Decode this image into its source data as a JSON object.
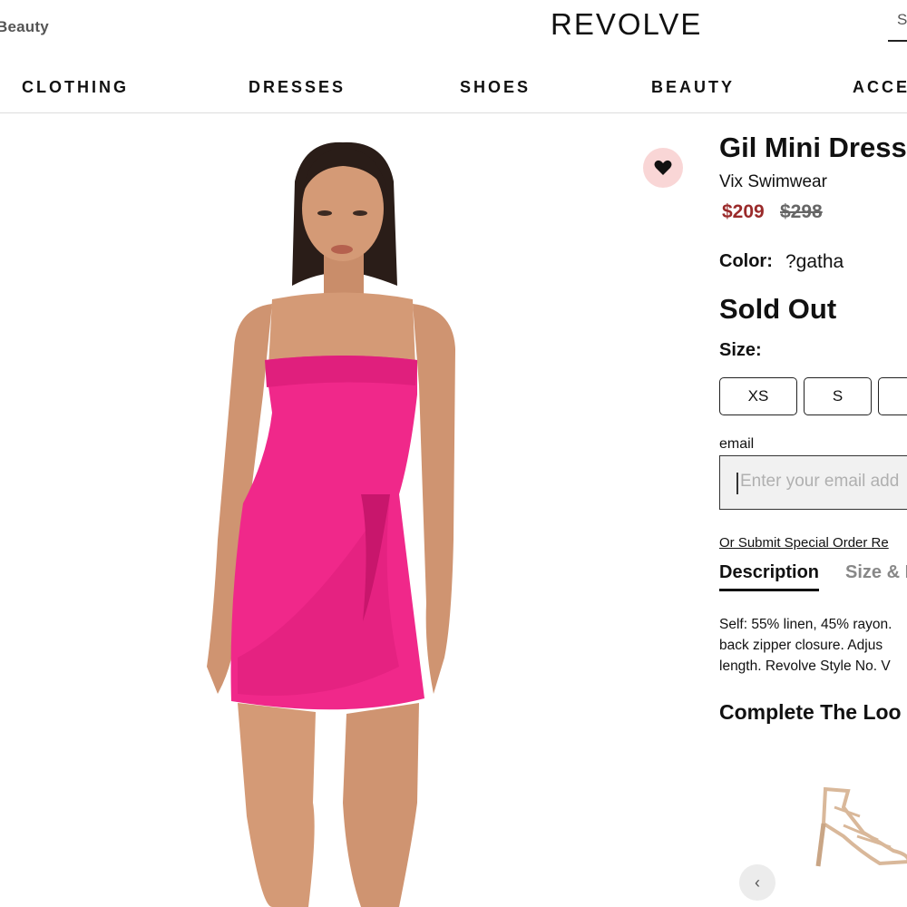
{
  "header": {
    "beauty_link": "Beauty",
    "logo": "REVOLVE",
    "search_fragment": "S"
  },
  "nav": {
    "items": [
      {
        "label": "CLOTHING"
      },
      {
        "label": "DRESSES"
      },
      {
        "label": "SHOES"
      },
      {
        "label": "BEAUTY"
      },
      {
        "label": "ACCE"
      }
    ]
  },
  "product": {
    "title": "Gil Mini Dress",
    "brand": "Vix Swimwear",
    "sale_price": "$209",
    "original_price": "$298",
    "color_label": "Color:",
    "color_value": "?gatha",
    "availability": "Sold Out",
    "size_label": "Size:",
    "sizes": [
      {
        "label": "XS"
      },
      {
        "label": "S"
      },
      {
        "label": ""
      }
    ],
    "email_label": "email",
    "email_placeholder": "Enter your email add",
    "special_order_link": "Or Submit Special Order Re",
    "favorite_icon": "heart-icon",
    "dress_color": "#f0288a"
  },
  "tabs": {
    "description": "Description",
    "size_fit": "Size & I"
  },
  "description": {
    "lines": [
      "Self: 55% linen, 45% rayon.",
      "back zipper closure. Adjus",
      "length. Revolve Style No. V"
    ]
  },
  "complete_the_look": {
    "heading": "Complete The Loo",
    "prev_icon": "chevron-left-icon"
  },
  "colors": {
    "sale_price": "#9a2a2a",
    "favorite_bg": "#f9d6d6",
    "dress": "#f0288a"
  }
}
